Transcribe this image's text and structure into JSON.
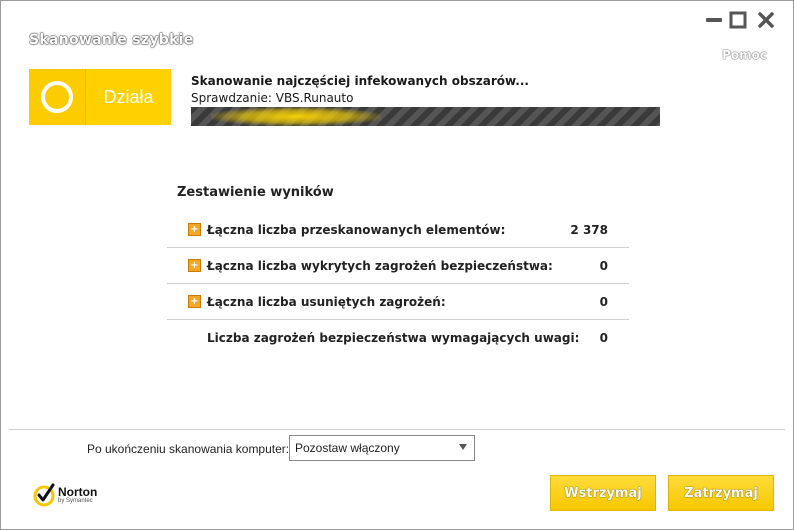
{
  "window": {
    "title": "Skanowanie szybkie",
    "help_label": "Pomoc"
  },
  "status": {
    "label": "Działa",
    "color": "#ffd100"
  },
  "scan": {
    "title": "Skanowanie najczęściej infekowanych obszarów...",
    "checking": "Sprawdzanie: VBS.Runauto"
  },
  "summary": {
    "title": "Zestawienie wyników",
    "rows": [
      {
        "label": "Łączna liczba przeskanowanych elementów:",
        "value": "2 378",
        "expandable": true
      },
      {
        "label": "Łączna liczba wykrytych zagrożeń bezpieczeństwa:",
        "value": "0",
        "expandable": true
      },
      {
        "label": "Łączna liczba usuniętych zagrożeń:",
        "value": "0",
        "expandable": true
      },
      {
        "label": "Liczba zagrożeń bezpieczeństwa wymagających uwagi:",
        "value": "0",
        "expandable": false
      }
    ]
  },
  "after_scan": {
    "label": "Po ukończeniu skanowania komputer:",
    "selected": "Pozostaw włączony"
  },
  "logo": {
    "name": "Norton",
    "by": "by Symantec"
  },
  "buttons": {
    "pause": "Wstrzymaj",
    "stop": "Zatrzymaj"
  },
  "icons": [
    "minimize-icon",
    "maximize-icon",
    "close-icon",
    "expand-icon",
    "dropdown-arrow-icon",
    "norton-check-icon"
  ]
}
